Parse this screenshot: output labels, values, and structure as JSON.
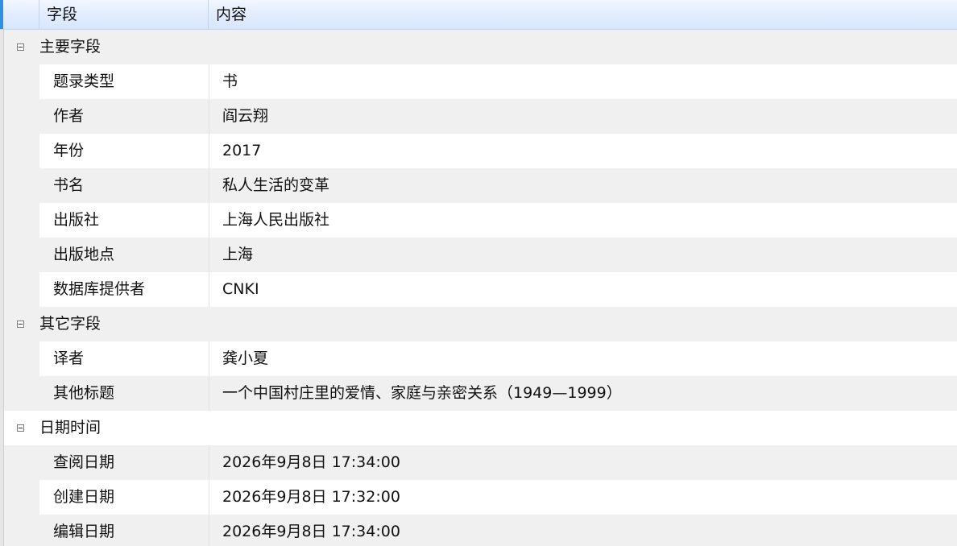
{
  "header": {
    "field_label": "字段",
    "content_label": "内容"
  },
  "groups": [
    {
      "title": "主要字段",
      "rows": [
        {
          "field": "题录类型",
          "value": "书"
        },
        {
          "field": "作者",
          "value": "阎云翔"
        },
        {
          "field": "年份",
          "value": "2017"
        },
        {
          "field": "书名",
          "value": "私人生活的变革"
        },
        {
          "field": "出版社",
          "value": "上海人民出版社"
        },
        {
          "field": "出版地点",
          "value": "上海"
        },
        {
          "field": "数据库提供者",
          "value": "CNKI"
        }
      ]
    },
    {
      "title": "其它字段",
      "rows": [
        {
          "field": "译者",
          "value": "龚小夏"
        },
        {
          "field": "其他标题",
          "value": "一个中国村庄里的爱情、家庭与亲密关系（1949—1999）"
        }
      ]
    },
    {
      "title": "日期时间",
      "rows": [
        {
          "field": "查阅日期",
          "value": "2026年9月8日 17:34:00"
        },
        {
          "field": "创建日期",
          "value": "2026年9月8日 17:32:00"
        },
        {
          "field": "编辑日期",
          "value": "2026年9月8日 17:34:00"
        }
      ]
    }
  ]
}
